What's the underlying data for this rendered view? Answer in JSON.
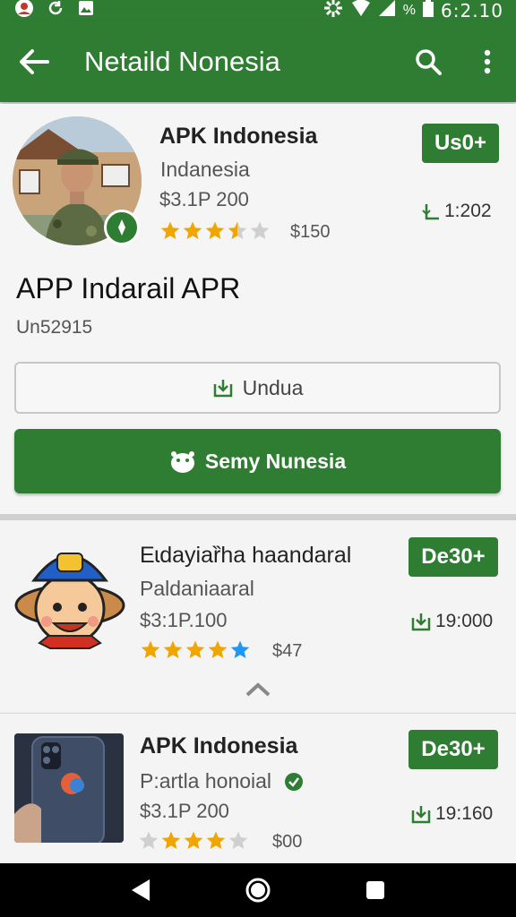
{
  "status_bar": {
    "time": "6:2.10",
    "battery": "%",
    "icons": [
      "avatar-icon",
      "sync-icon",
      "image-icon",
      "settings-icon",
      "wifi-icon",
      "signal-icon",
      "battery-icon"
    ]
  },
  "app_bar": {
    "title": "Netaild Nonesia",
    "icons": [
      "back-arrow-icon",
      "search-icon",
      "more-vert-icon"
    ]
  },
  "app": {
    "name": "APK Indonesia",
    "developer": "Indanesia",
    "price_line": "$3.1P 200",
    "rating_stars": 3.5,
    "rating_text": "$150",
    "install_button": "Us0+",
    "downloads": "1:202",
    "headline": "APP Indarail APR",
    "version": "Un52915",
    "outline_button": "Undua",
    "primary_button": "Semy Nunesia"
  },
  "list": [
    {
      "name": "Eɩdayiaȑha haandaral",
      "subtitle": "Paldaniaaral",
      "price_line": "$3:1P.100",
      "rating_stars": 5,
      "rating_text": "$47",
      "button": "De30+",
      "downloads": "19:000"
    },
    {
      "name": "APK Indonesia",
      "subtitle": "P:artla honoial",
      "price_line": "$3.1P 200",
      "rating_stars": 3.5,
      "rating_text": "$00",
      "button": "De30+",
      "downloads": "19:160"
    }
  ],
  "nav_bar": {
    "icons": [
      "back-triangle-icon",
      "home-circle-icon",
      "recents-square-icon"
    ]
  },
  "colors": {
    "primary": "#2e7d32",
    "star": "#f0a500",
    "star_blue": "#2196f3",
    "star_empty": "#cfcfcf"
  }
}
